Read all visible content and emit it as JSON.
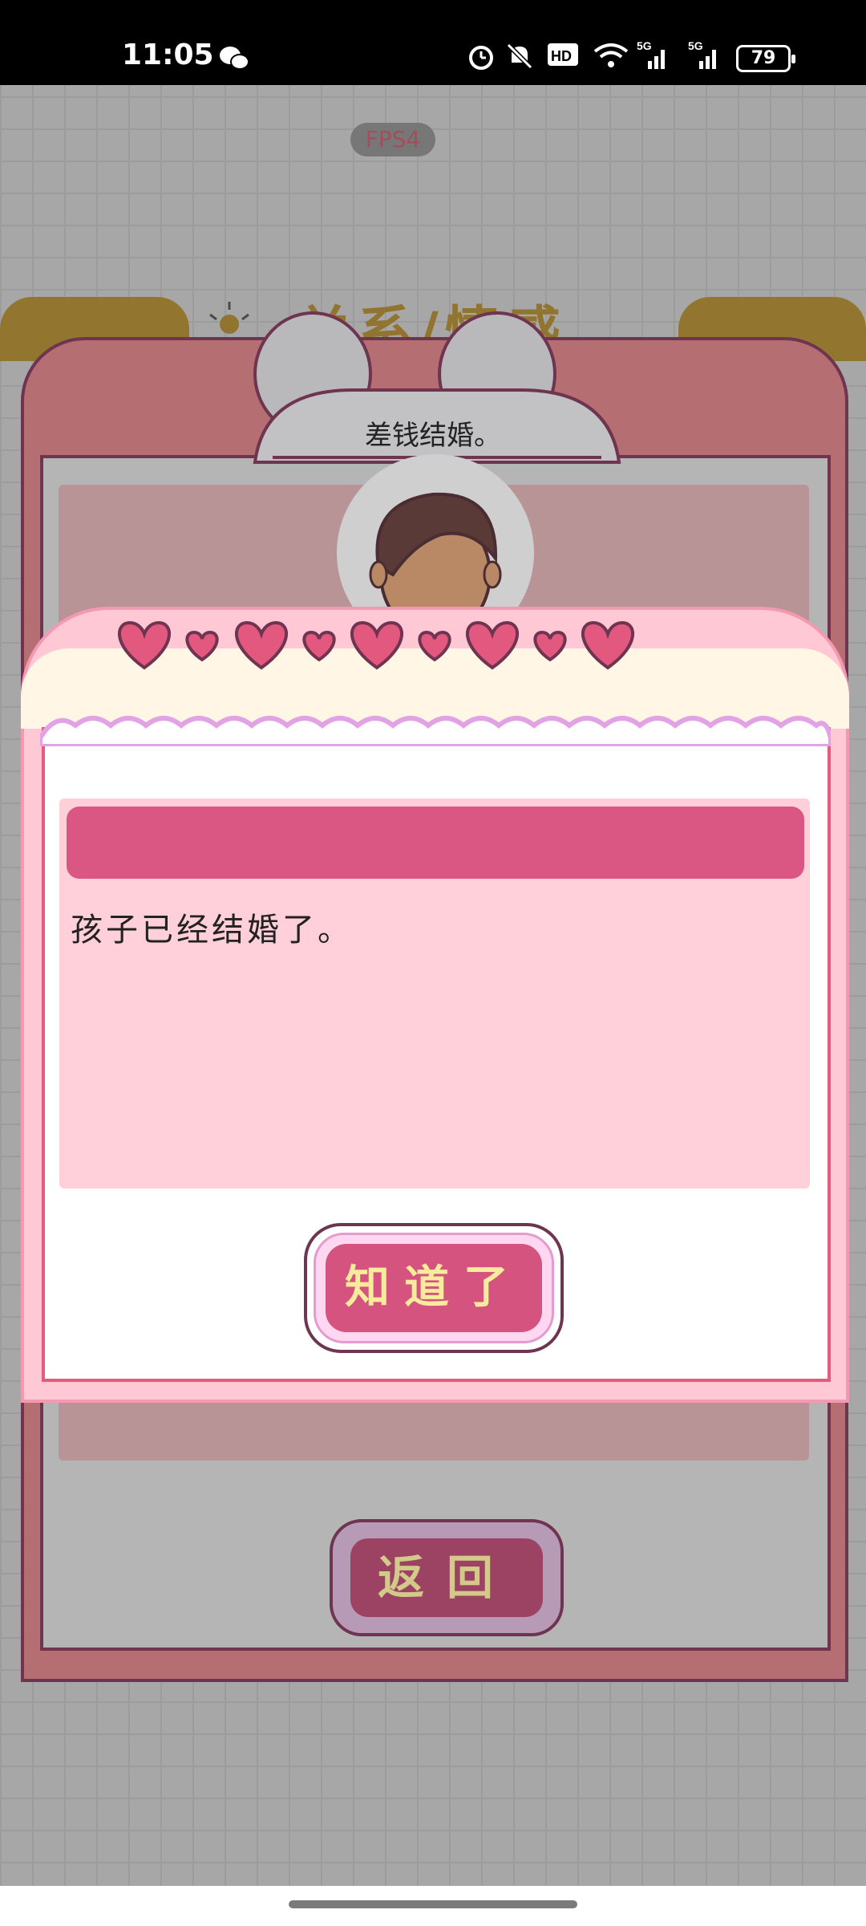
{
  "status_bar": {
    "time": "11:05",
    "battery": "79",
    "icons": [
      "wechat-icon",
      "alarm-icon",
      "mute-icon",
      "hd-icon",
      "wifi-icon",
      "5g-signal-icon",
      "5g-signal-icon"
    ]
  },
  "game": {
    "fps": "FPS4",
    "background_title": "关系/情感",
    "speech_bubble": "差钱结婚。",
    "return_button": "返回"
  },
  "dialog": {
    "message": "孩子已经结婚了。",
    "confirm_button": "知道了",
    "hearts": 9
  },
  "colors": {
    "dialog_pink": "#ffc8d4",
    "header_pink": "#d95782",
    "button_text": "#f7ec9b"
  }
}
